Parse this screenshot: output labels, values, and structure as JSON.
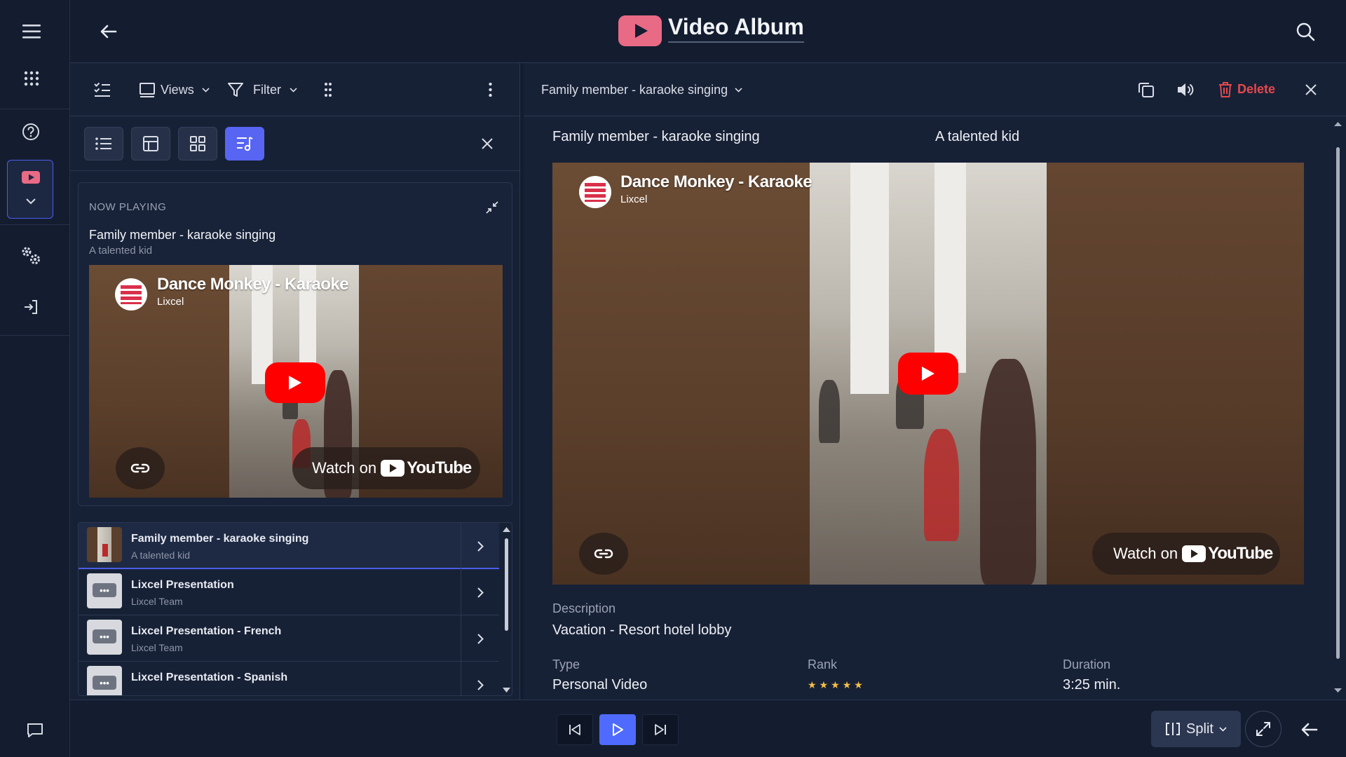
{
  "header": {
    "title": "Video Album"
  },
  "left_toolbar": {
    "views_label": "Views",
    "filter_label": "Filter"
  },
  "now_playing": {
    "caption": "NOW PLAYING",
    "title": "Family member - karaoke singing",
    "subtitle": "A talented kid"
  },
  "video": {
    "title": "Dance Monkey - Karaoke",
    "channel": "Lixcel",
    "watch_on": "Watch on",
    "brand": "YouTube"
  },
  "list": {
    "items": [
      {
        "title": "Family member - karaoke singing",
        "subtitle": "A talented kid",
        "selected": true
      },
      {
        "title": "Lixcel Presentation",
        "subtitle": "Lixcel Team"
      },
      {
        "title": "Lixcel Presentation - French",
        "subtitle": "Lixcel Team"
      },
      {
        "title": "Lixcel Presentation - Spanish",
        "subtitle": ""
      }
    ]
  },
  "right_toolbar": {
    "title": "Family member - karaoke singing",
    "delete_label": "Delete"
  },
  "detail": {
    "title": "Family member - karaoke singing",
    "subtitle": "A talented kid",
    "description_label": "Description",
    "description": "Vacation - Resort hotel lobby",
    "type_label": "Type",
    "type": "Personal Video",
    "rank_label": "Rank",
    "rank": 5,
    "duration_label": "Duration",
    "duration": "3:25 min."
  },
  "bottom_bar": {
    "split_label": "Split"
  },
  "colors": {
    "accent": "#5865f2",
    "danger": "#e5484d",
    "youtube_red": "#ff0000",
    "star": "#f6c046"
  },
  "icons": [
    "hamburger-icon",
    "apps-grid-icon",
    "help-icon",
    "video-album-icon",
    "chevron-down-icon",
    "settings-icon",
    "sign-in-icon",
    "chat-icon",
    "back-arrow-icon",
    "search-icon",
    "checklist-icon",
    "views-icon",
    "filter-icon",
    "drag-handle-icon",
    "more-vertical-icon",
    "list-view-icon",
    "table-view-icon",
    "grid-view-icon",
    "playlist-view-icon",
    "close-icon",
    "collapse-icon",
    "chevron-right-icon",
    "copy-icon",
    "volume-icon",
    "trash-icon",
    "skip-previous-icon",
    "play-icon",
    "skip-next-icon",
    "split-icon",
    "fullscreen-icon"
  ]
}
